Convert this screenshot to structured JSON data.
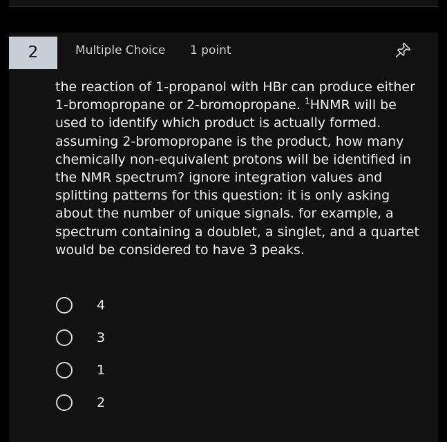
{
  "question": {
    "number": "2",
    "type": "Multiple Choice",
    "points": "1 point",
    "pin_icon": "pin-icon",
    "text_part1": "the reaction of 1-propanol with HBr can produce either 1-bromopropane or 2-bromopropane.",
    "superscript": "1",
    "text_part2": "HNMR will be used to identify which product is actually formed. assuming 2-bromopropane is the product, how many chemically non-equivalent protons will be identified in the NMR spectrum? ignore integration values and splitting patterns for this question: it is only asking about the number of unique signals. for example, a spectrum containing a doublet, a singlet, and a quartet would be considered to have 3 peaks."
  },
  "options": [
    {
      "label": "4"
    },
    {
      "label": "3"
    },
    {
      "label": "1"
    },
    {
      "label": "2"
    }
  ],
  "colors": {
    "background": "#000000",
    "card": "#121212",
    "number_badge": "#c7ced6",
    "text": "#ededed"
  }
}
